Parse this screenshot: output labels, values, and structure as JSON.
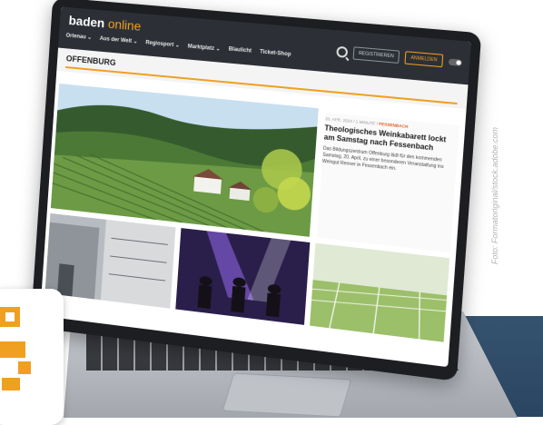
{
  "site": {
    "logo_part1": "baden",
    "logo_part2": "online",
    "nav": [
      "Ortenau ⌄",
      "Aus der Welt ⌄",
      "Regiosport ⌄",
      "Marktplatz ⌄",
      "Blaulicht",
      "Ticket-Shop"
    ],
    "register_label": "REGISTRIEREN",
    "login_label": "ANMELDEN",
    "section_title": "OFFENBURG"
  },
  "article": {
    "meta_date": "20. APR. 2024 / 1 MINUTE /",
    "meta_tag": "FESSENBACH",
    "title": "Theologisches Weinkabarett lockt am Samstag nach Fessenbach",
    "teaser": "Das Bildungszentrum Offenburg lädt für den kommenden Samstag, 20. April, zu einer besonderen Veranstaltung ins Weingut Renner in Fessenbach ein."
  },
  "credit": "Foto: Formatoriginal/stock.adobe.com",
  "colors": {
    "accent": "#f0a020",
    "header_bg": "#2c3036",
    "navy": "#2e4a66"
  }
}
